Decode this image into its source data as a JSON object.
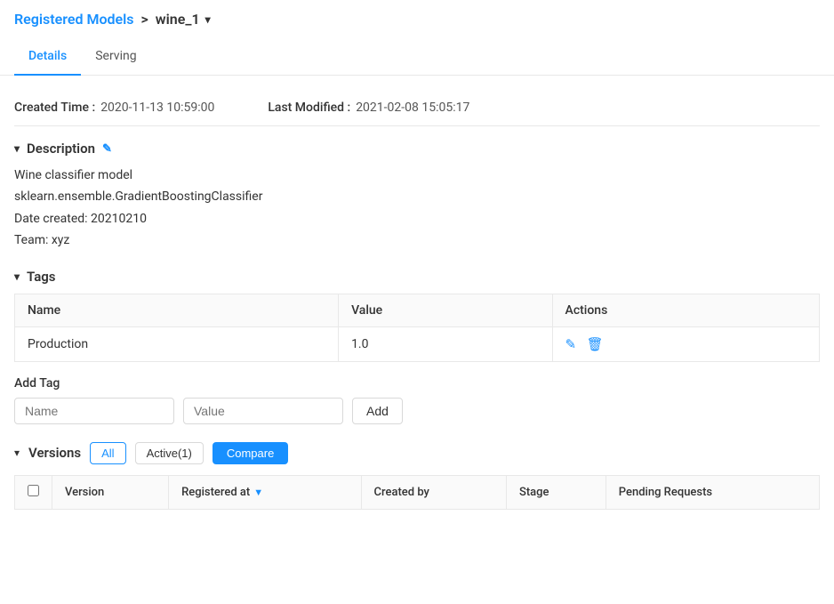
{
  "breadcrumb": {
    "parent_label": "Registered Models",
    "separator": ">",
    "current_model": "wine_1",
    "dropdown_icon": "▾"
  },
  "tabs": [
    {
      "id": "details",
      "label": "Details",
      "active": true
    },
    {
      "id": "serving",
      "label": "Serving",
      "active": false
    }
  ],
  "meta": {
    "created_label": "Created Time :",
    "created_value": "2020-11-13 10:59:00",
    "modified_label": "Last Modified :",
    "modified_value": "2021-02-08 15:05:17"
  },
  "description": {
    "section_title": "Description",
    "toggle": "▾",
    "edit_icon": "✎",
    "lines": [
      "Wine classifier model",
      "sklearn.ensemble.GradientBoostingClassifier",
      "Date created: 20210210",
      "Team: xyz"
    ]
  },
  "tags": {
    "section_title": "Tags",
    "toggle": "▾",
    "columns": [
      "Name",
      "Value",
      "Actions"
    ],
    "rows": [
      {
        "name": "Production",
        "value": "1.0"
      }
    ]
  },
  "add_tag": {
    "label": "Add Tag",
    "name_placeholder": "Name",
    "value_placeholder": "Value",
    "button_label": "Add"
  },
  "versions": {
    "section_title": "Versions",
    "toggle": "▾",
    "filter_all": "All",
    "filter_active": "Active(1)",
    "compare_button": "Compare",
    "columns": [
      "",
      "Version",
      "Registered at",
      "Created by",
      "Stage",
      "Pending Requests"
    ]
  }
}
